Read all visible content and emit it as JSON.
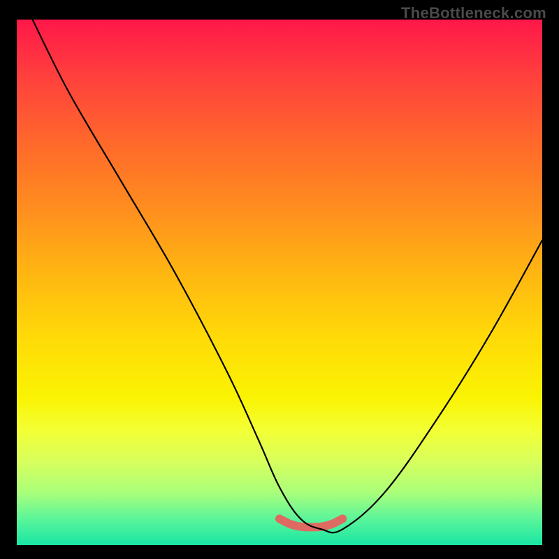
{
  "watermark": "TheBottleneck.com",
  "colors": {
    "frame_bg": "#000000",
    "gradient_top": "#ff1749",
    "gradient_bottom": "#18e6a4",
    "curve": "#000000",
    "accent": "#de6a62",
    "watermark": "#4a4a4a"
  },
  "chart_data": {
    "type": "line",
    "title": "",
    "xlabel": "",
    "ylabel": "",
    "xlim": [
      0,
      100
    ],
    "ylim": [
      0,
      100
    ],
    "series": [
      {
        "name": "bottleneck-curve",
        "x": [
          3,
          10,
          20,
          30,
          40,
          46,
          50,
          54,
          58,
          62,
          70,
          80,
          90,
          100
        ],
        "y": [
          100,
          86,
          69,
          52,
          33,
          20,
          11,
          5,
          3,
          3,
          10,
          24,
          40,
          58
        ]
      },
      {
        "name": "highlight-region",
        "x": [
          50,
          52,
          54,
          56,
          58,
          60,
          62
        ],
        "y": [
          5,
          4,
          3.5,
          3.4,
          3.5,
          4,
          5
        ]
      }
    ],
    "annotations": []
  }
}
